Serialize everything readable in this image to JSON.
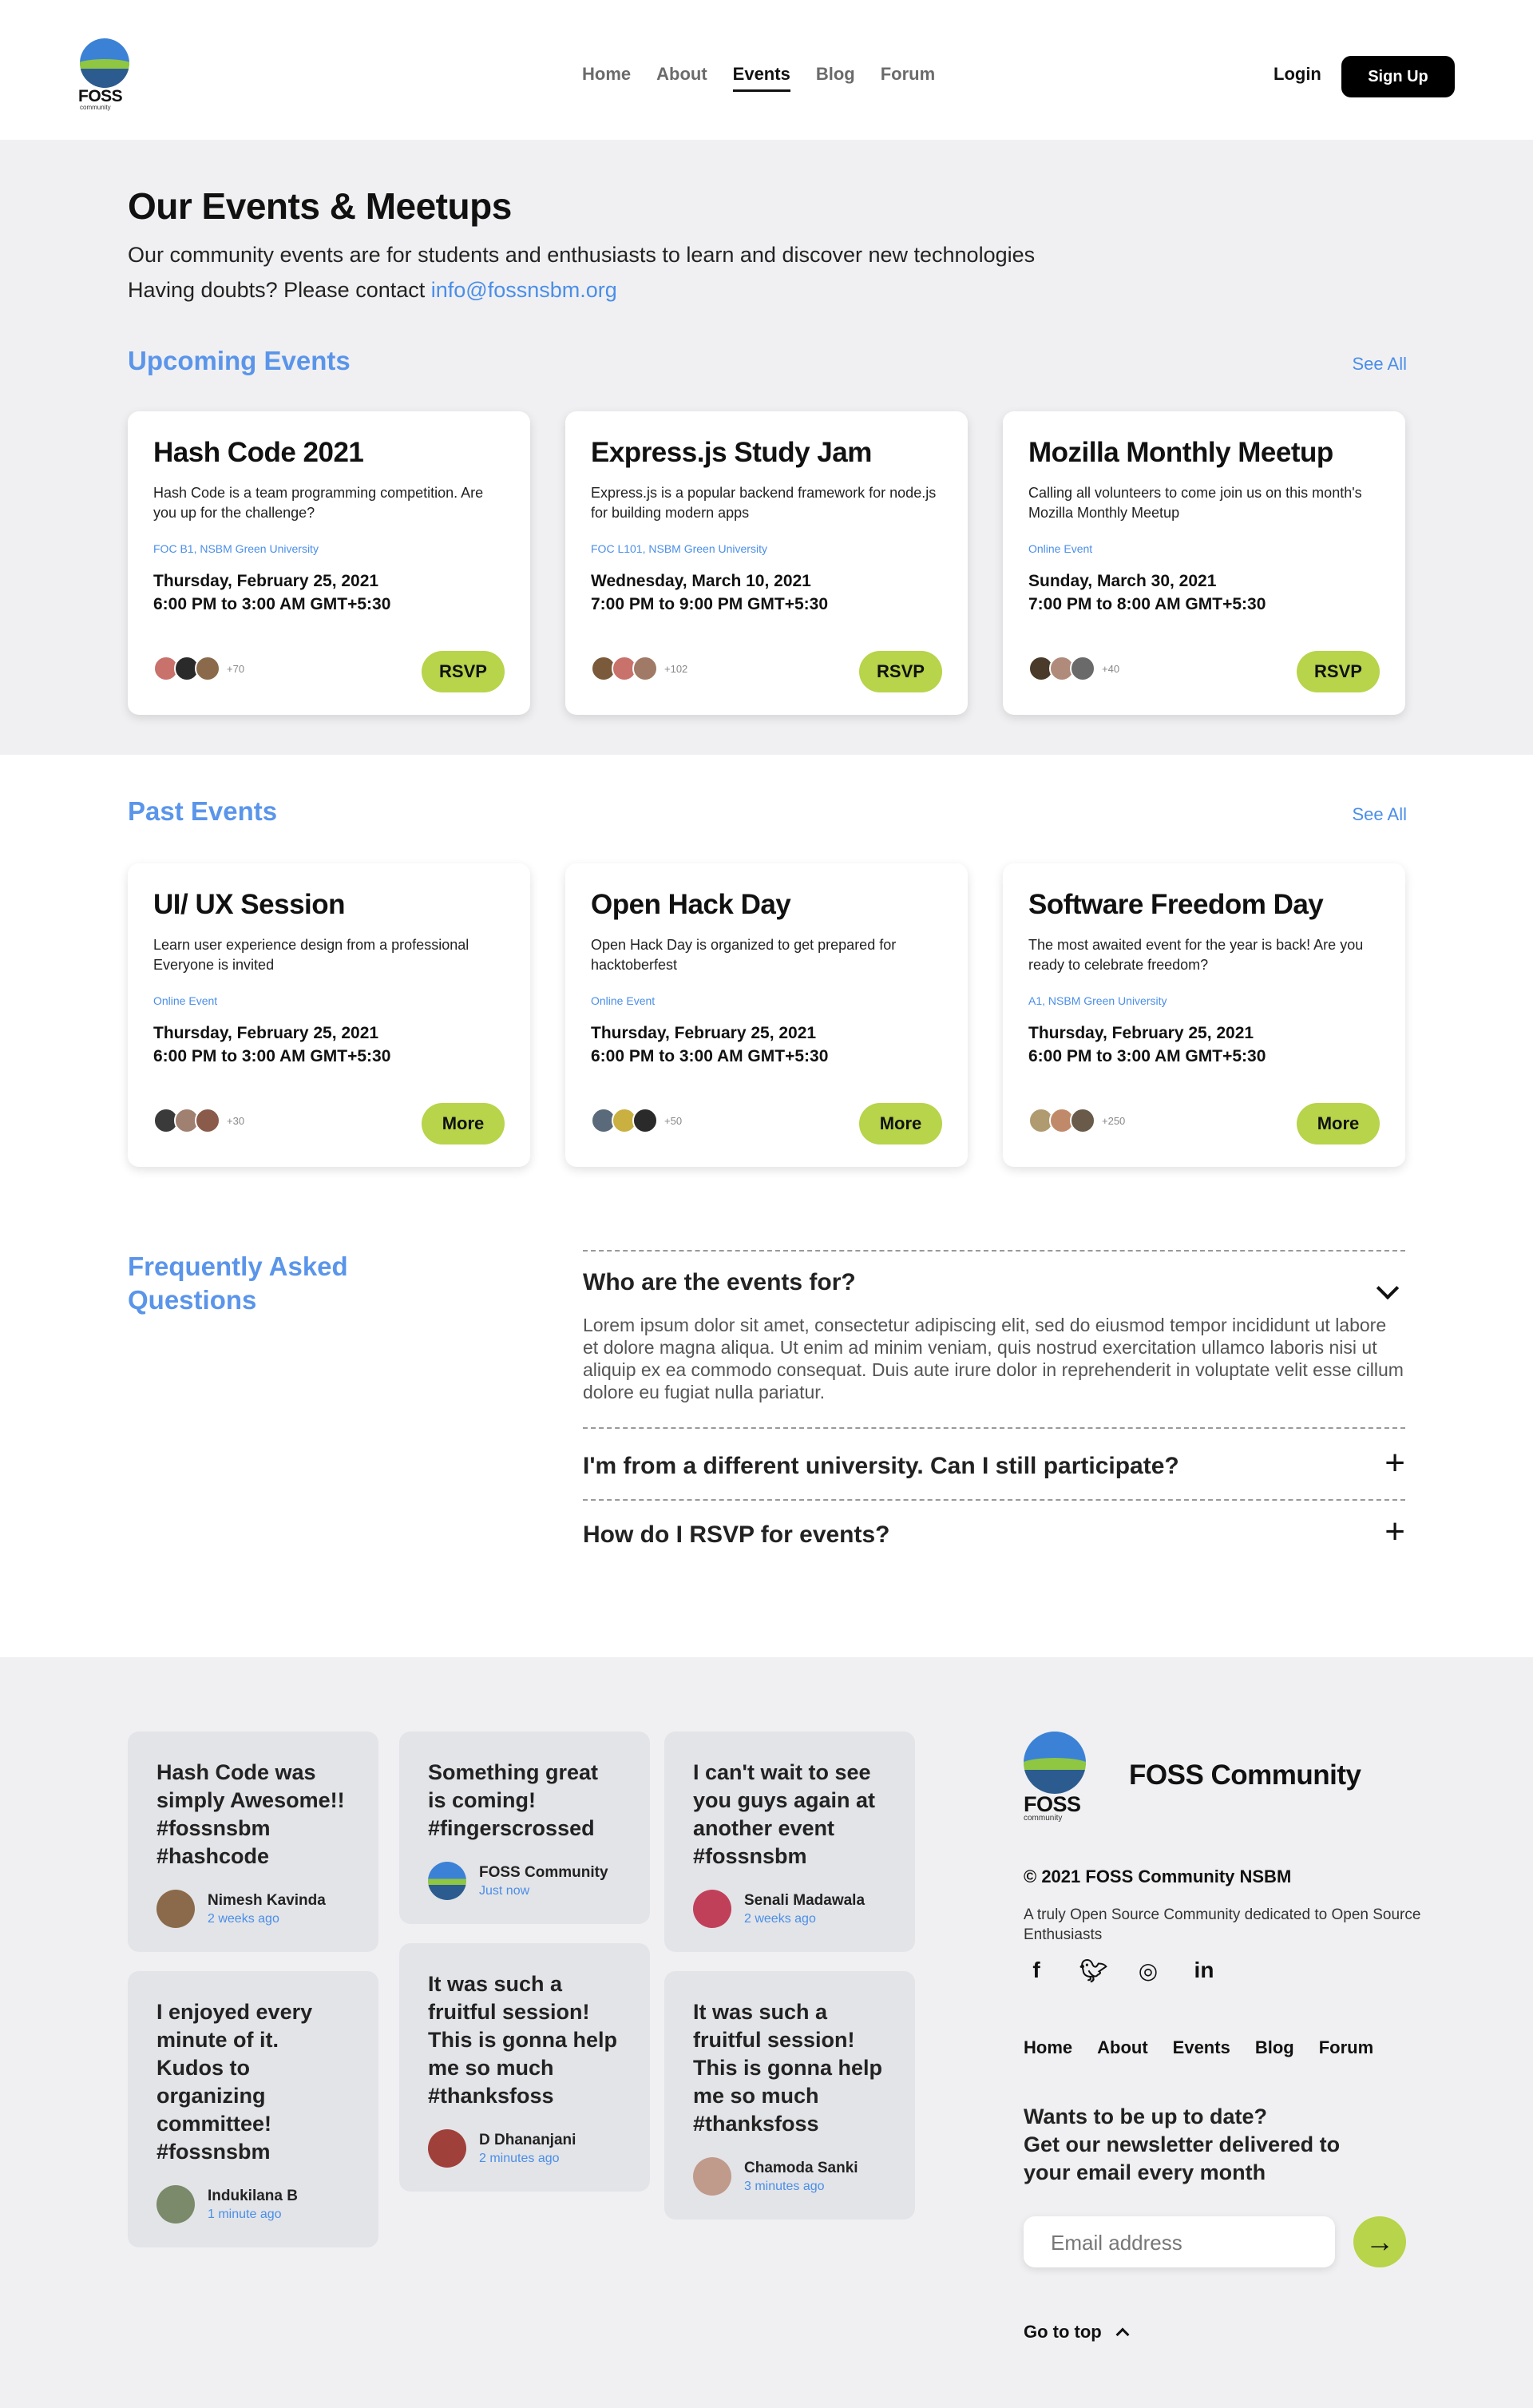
{
  "nav": {
    "logo_text": "FOSS",
    "logo_sub": "community",
    "links": [
      "Home",
      "About",
      "Events",
      "Blog",
      "Forum"
    ],
    "active": "Events",
    "login": "Login",
    "signup": "Sign Up"
  },
  "hero": {
    "title": "Our Events & Meetups",
    "line1": "Our community events are for students and enthusiasts to learn and discover new technologies",
    "line2": "Having doubts? Please contact ",
    "email": "info@fossnsbm.org"
  },
  "upcoming": {
    "heading": "Upcoming Events",
    "see_all": "See All",
    "events": [
      {
        "title": "Hash Code 2021",
        "desc": "Hash Code is a team programming competition. Are you up for the challenge?",
        "location": "FOC B1, NSBM Green University",
        "date": "Thursday, February 25, 2021",
        "time": "6:00 PM to 3:00 AM GMT+5:30",
        "count": "+70",
        "button": "RSVP"
      },
      {
        "title": "Express.js Study Jam",
        "desc": "Express.js is a popular backend framework for node.js for building modern apps",
        "location": "FOC L101, NSBM Green University",
        "date": "Wednesday, March 10, 2021",
        "time": "7:00 PM to 9:00 PM GMT+5:30",
        "count": "+102",
        "button": "RSVP"
      },
      {
        "title": "Mozilla Monthly Meetup",
        "desc": "Calling all volunteers to come join us on this month's Mozilla Monthly Meetup",
        "location": "Online Event",
        "date": "Sunday, March 30, 2021",
        "time": "7:00 PM to 8:00 AM GMT+5:30",
        "count": "+40",
        "button": "RSVP"
      }
    ]
  },
  "past": {
    "heading": "Past Events",
    "see_all": "See All",
    "events": [
      {
        "title": "UI/ UX Session",
        "desc": "Learn user experience design from a professional Everyone is invited",
        "location": "Online Event",
        "date": "Thursday, February 25, 2021",
        "time": "6:00 PM to 3:00 AM GMT+5:30",
        "count": "+30",
        "button": "More"
      },
      {
        "title": "Open Hack Day",
        "desc": "Open Hack Day is organized to get prepared for hacktoberfest",
        "location": "Online Event",
        "date": "Thursday, February 25, 2021",
        "time": "6:00 PM to 3:00 AM GMT+5:30",
        "count": "+50",
        "button": "More"
      },
      {
        "title": "Software Freedom Day",
        "desc": "The most awaited event for the year is back! Are you ready to celebrate freedom?",
        "location": "A1, NSBM Green University",
        "date": "Thursday, February 25, 2021",
        "time": "6:00 PM to 3:00 AM GMT+5:30",
        "count": "+250",
        "button": "More"
      }
    ]
  },
  "faq": {
    "heading_line1": "Frequently Asked",
    "heading_line2": "Questions",
    "items": [
      {
        "q": "Who are the events for?",
        "a": "Lorem ipsum dolor sit amet, consectetur adipiscing elit, sed do eiusmod tempor incididunt ut labore et dolore magna aliqua. Ut enim ad minim veniam, quis nostrud exercitation ullamco laboris nisi ut aliquip ex ea commodo consequat. Duis aute irure dolor in reprehenderit in voluptate velit esse cillum dolore eu fugiat nulla pariatur.",
        "icon": "chevron-down-icon"
      },
      {
        "q": "I'm from a different university. Can I still participate?",
        "icon": "plus-icon"
      },
      {
        "q": "How do I RSVP for events?",
        "icon": "plus-icon"
      }
    ]
  },
  "testimonials": {
    "col1": [
      {
        "text": "Hash Code was simply Awesome!! #fossnsbm #hashcode",
        "name": "Nimesh Kavinda",
        "time": "2 weeks ago"
      },
      {
        "text": "I enjoyed every minute of it. Kudos to organizing committee! #fossnsbm",
        "name": "Indukilana B",
        "time": "1 minute ago"
      }
    ],
    "col2": [
      {
        "text": "Something great is coming! #fingerscrossed",
        "name": "FOSS Community",
        "time": "Just now"
      },
      {
        "text": "It was such a fruitful session! This is gonna help me so much #thanksfoss",
        "name": "D Dhananjani",
        "time": "2 minutes ago"
      }
    ],
    "col3": [
      {
        "text": "I can't wait to see you guys again at another event #fossnsbm",
        "name": "Senali Madawala",
        "time": "2 weeks ago"
      },
      {
        "text": "It was such a fruitful session! This is gonna help me so much #thanksfoss",
        "name": "Chamoda Sanki",
        "time": "3 minutes ago"
      }
    ]
  },
  "footer": {
    "brand": "FOSS Community",
    "copyright": "© 2021 FOSS Community NSBM",
    "tagline": "A truly Open Source Community dedicated to Open Source Enthusiasts",
    "social": [
      "facebook-icon",
      "twitter-icon",
      "instagram-icon",
      "linkedin-icon"
    ],
    "links": [
      "Home",
      "About",
      "Events",
      "Blog",
      "Forum"
    ],
    "newsletter": "Wants to be up to date? Get our newsletter delivered to your email every month",
    "newsletter_l1": "Wants to be up to date?",
    "newsletter_l2": "Get our newsletter delivered to",
    "newsletter_l3": "your email every month",
    "email_placeholder": "Email address",
    "go_top": "Go to top"
  },
  "colors": {
    "accent_blue": "#5a95ea",
    "button_green": "#b7d44a",
    "bg_grey": "#f0f0f2"
  }
}
